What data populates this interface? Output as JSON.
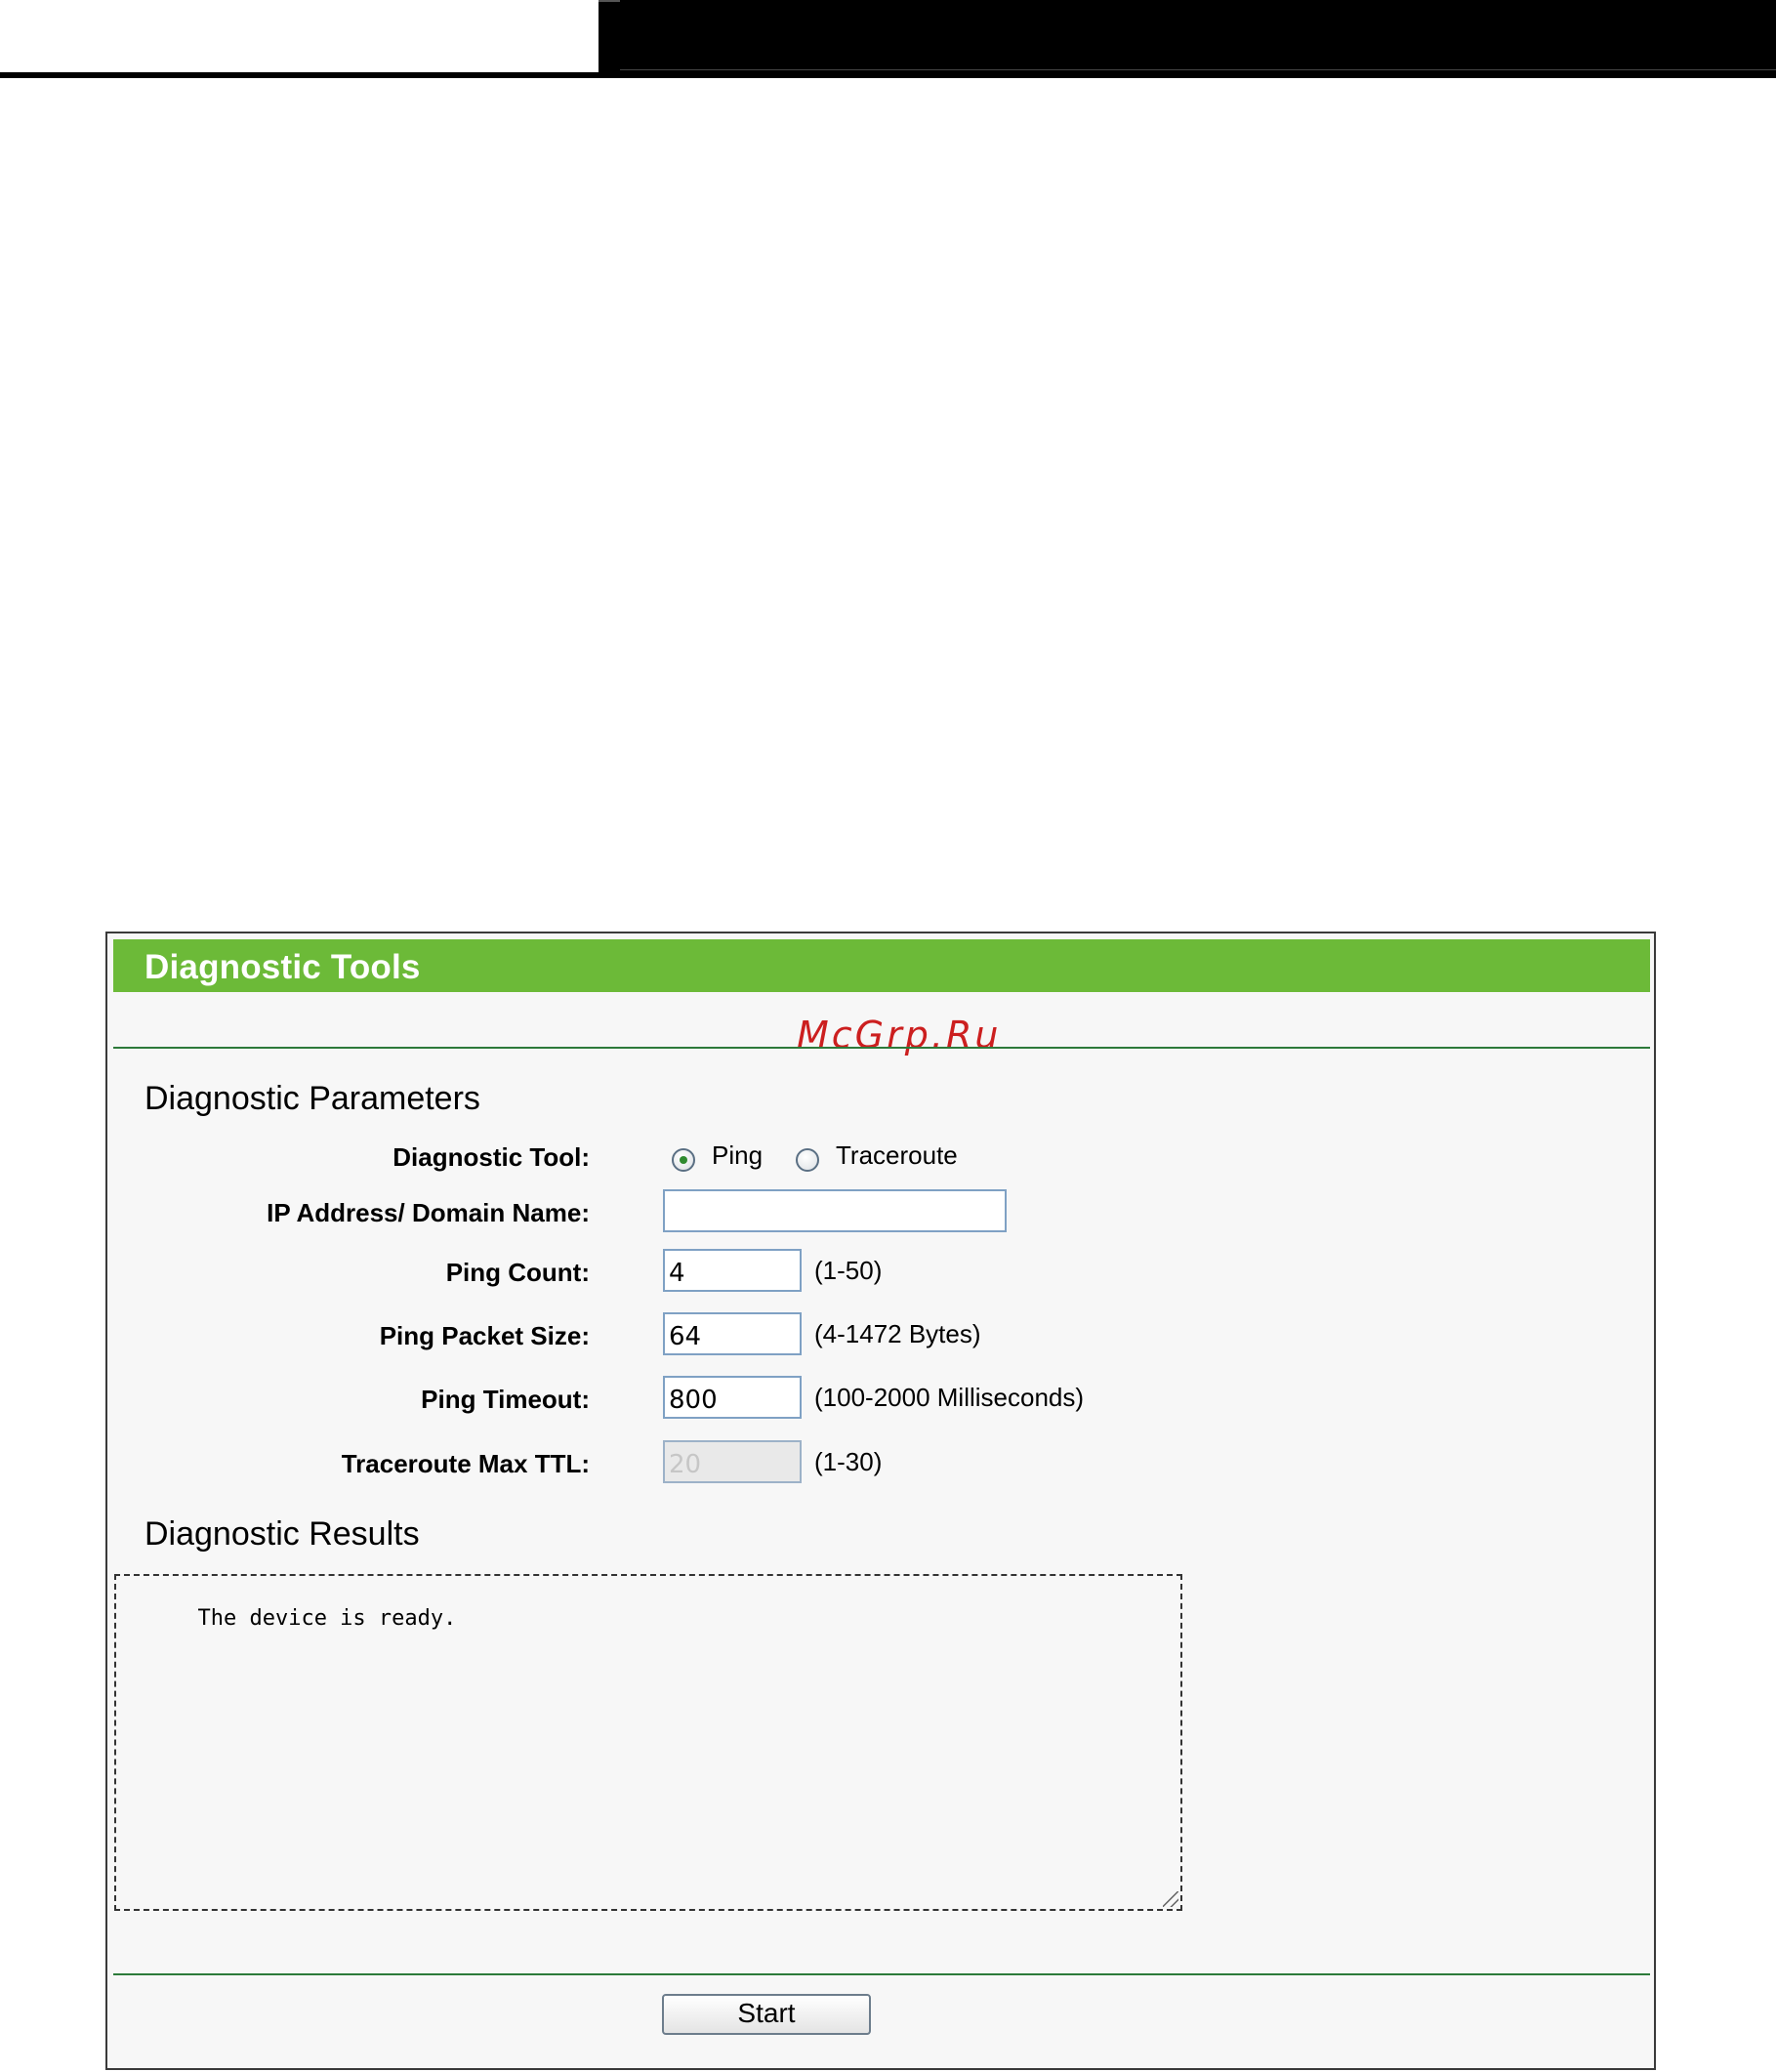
{
  "panel": {
    "title": "Diagnostic Tools",
    "header_color": "#6cba38",
    "watermark": "McGrp.Ru"
  },
  "parameters": {
    "heading": "Diagnostic Parameters",
    "diagnostic_tool": {
      "label": "Diagnostic Tool:",
      "options": [
        {
          "label": "Ping",
          "selected": true
        },
        {
          "label": "Traceroute",
          "selected": false
        }
      ]
    },
    "ip_address": {
      "label": "IP Address/ Domain Name:",
      "value": ""
    },
    "ping_count": {
      "label": "Ping Count:",
      "value": "4",
      "hint": "(1-50)"
    },
    "ping_packet_size": {
      "label": "Ping Packet Size:",
      "value": "64",
      "hint": "(4-1472 Bytes)"
    },
    "ping_timeout": {
      "label": "Ping Timeout:",
      "value": "800",
      "hint": "(100-2000 Milliseconds)"
    },
    "traceroute_max_ttl": {
      "label": "Traceroute Max TTL:",
      "value": "20",
      "hint": "(1-30)",
      "disabled": true
    }
  },
  "results": {
    "heading": "Diagnostic Results",
    "text": "The device is ready."
  },
  "actions": {
    "start_label": "Start"
  }
}
